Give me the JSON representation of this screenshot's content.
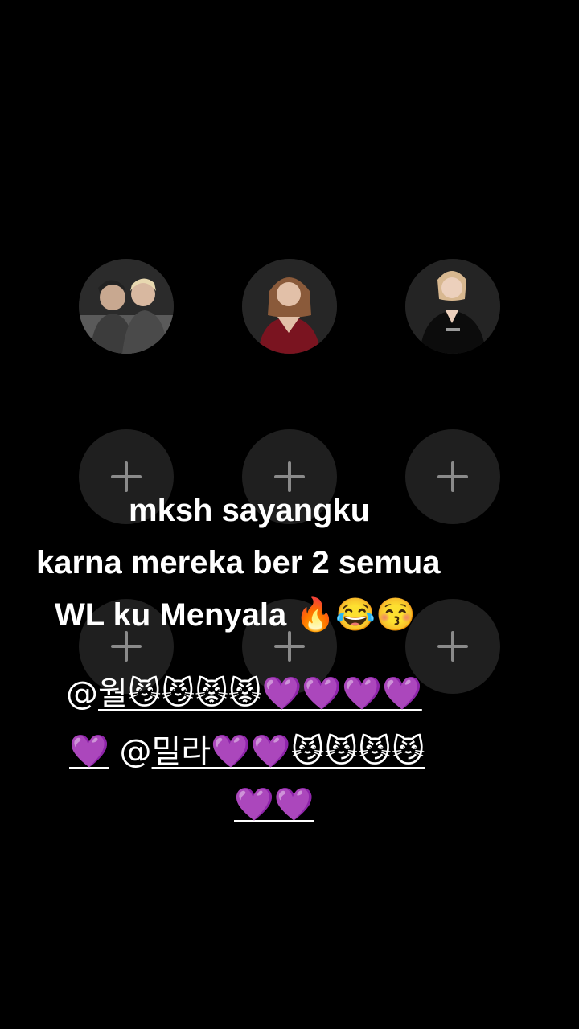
{
  "avatars": [
    {
      "icon": "photo-two-men-avatar"
    },
    {
      "icon": "photo-woman-red-dress-avatar"
    },
    {
      "icon": "photo-woman-black-dress-avatar"
    }
  ],
  "add_slots": [
    {
      "icon": "plus-icon"
    },
    {
      "icon": "plus-icon"
    },
    {
      "icon": "plus-icon"
    },
    {
      "icon": "plus-icon"
    },
    {
      "icon": "plus-icon"
    },
    {
      "icon": "plus-icon"
    }
  ],
  "caption": {
    "line1": "mksh sayangku",
    "line2": "karna mereka ber 2 semua",
    "line3": "WL ku Menyala 🔥😂😚"
  },
  "mentions": {
    "line1_prefix": "@",
    "line1_link": "월😼😼😾😾💜💜💜💜",
    "line2_link_a": "💜",
    "line2_mid": " @",
    "line2_link_b": "밀라💜💜😼😼😼😼",
    "line3_link": "💜💜"
  }
}
